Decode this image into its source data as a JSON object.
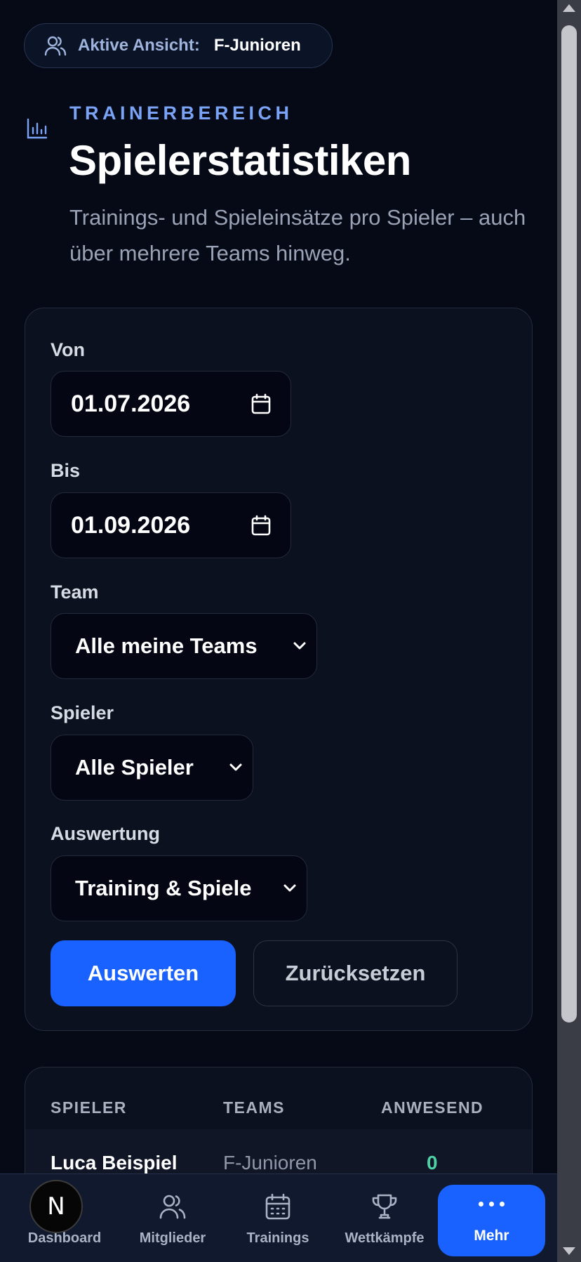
{
  "active_view": {
    "label": "Aktive Ansicht:",
    "value": "F-Junioren"
  },
  "header": {
    "eyebrow": "TRAINERBEREICH",
    "title": "Spielerstatistiken",
    "subtitle": "Trainings- und Spieleinsätze pro Spieler – auch über mehrere Teams hinweg."
  },
  "filters": {
    "from": {
      "label": "Von",
      "value": "01.07.2026"
    },
    "to": {
      "label": "Bis",
      "value": "01.09.2026"
    },
    "team": {
      "label": "Team",
      "value": "Alle meine Teams"
    },
    "player": {
      "label": "Spieler",
      "value": "Alle Spieler"
    },
    "evaluation": {
      "label": "Auswertung",
      "value": "Training & Spiele"
    },
    "submit_label": "Auswerten",
    "reset_label": "Zurücksetzen"
  },
  "table": {
    "columns": [
      "SPIELER",
      "TEAMS",
      "ANWESEND"
    ],
    "rows": [
      {
        "player": "Luca Beispiel",
        "teams": "F-Junioren",
        "present": "0"
      }
    ]
  },
  "bottom_nav": {
    "items": [
      {
        "label": "Dashboard",
        "icon": "home-icon"
      },
      {
        "label": "Mitglieder",
        "icon": "users-icon"
      },
      {
        "label": "Trainings",
        "icon": "calendar-icon"
      },
      {
        "label": "Wettkämpfe",
        "icon": "trophy-icon"
      },
      {
        "label": "Mehr",
        "icon": "more-dots-icon"
      }
    ],
    "avatar_letter": "N"
  },
  "colors": {
    "background": "#060a17",
    "accent": "#1a62ff",
    "eyebrow": "#7aa3f5",
    "present_count": "#4fd1a5"
  }
}
